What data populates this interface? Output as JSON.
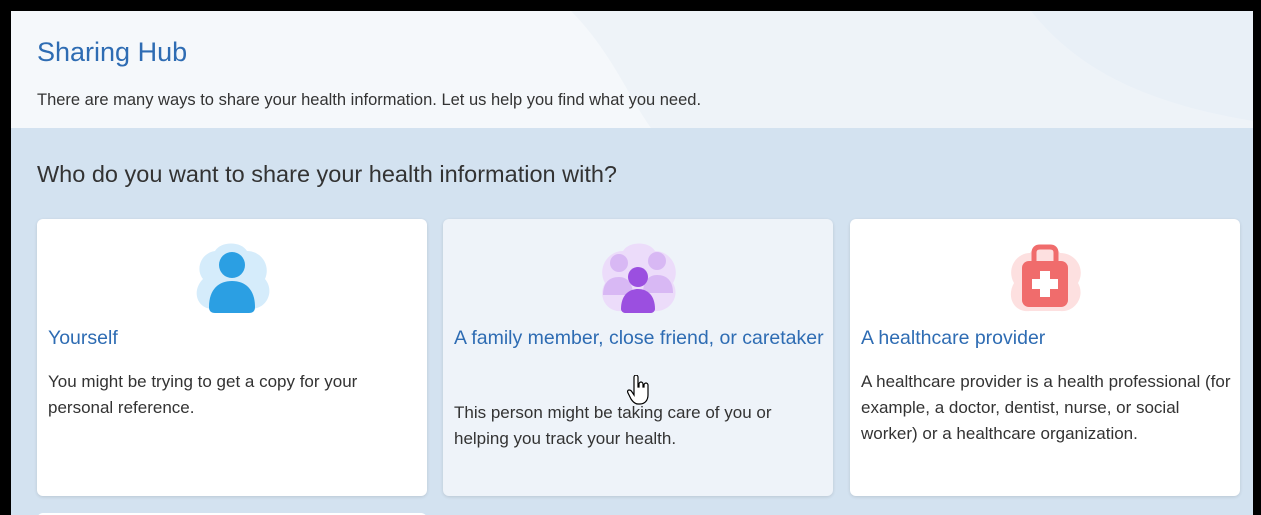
{
  "header": {
    "title": "Sharing Hub",
    "subtitle": "There are many ways to share your health information. Let us help you find what you need."
  },
  "main": {
    "question": "Who do you want to share your health information with?",
    "cards": [
      {
        "title": "Yourself",
        "description": "You might be trying to get a copy for your personal reference.",
        "icon": "person-icon",
        "accent": "#2b9fe3"
      },
      {
        "title": "A family member, close friend, or caretaker",
        "description": "This person might be taking care of you or helping you track your health.",
        "icon": "family-group-icon",
        "accent": "#9b4fe0"
      },
      {
        "title": "A healthcare provider",
        "description": "A healthcare provider is a health professional (for example, a doctor, dentist, nurse, or social worker) or a healthcare organization.",
        "icon": "medical-bag-icon",
        "accent": "#f06c6c"
      }
    ]
  },
  "colors": {
    "title_blue": "#2e6cb3",
    "section_background": "#d3e2f0",
    "card_hover": "#eef3f9"
  }
}
